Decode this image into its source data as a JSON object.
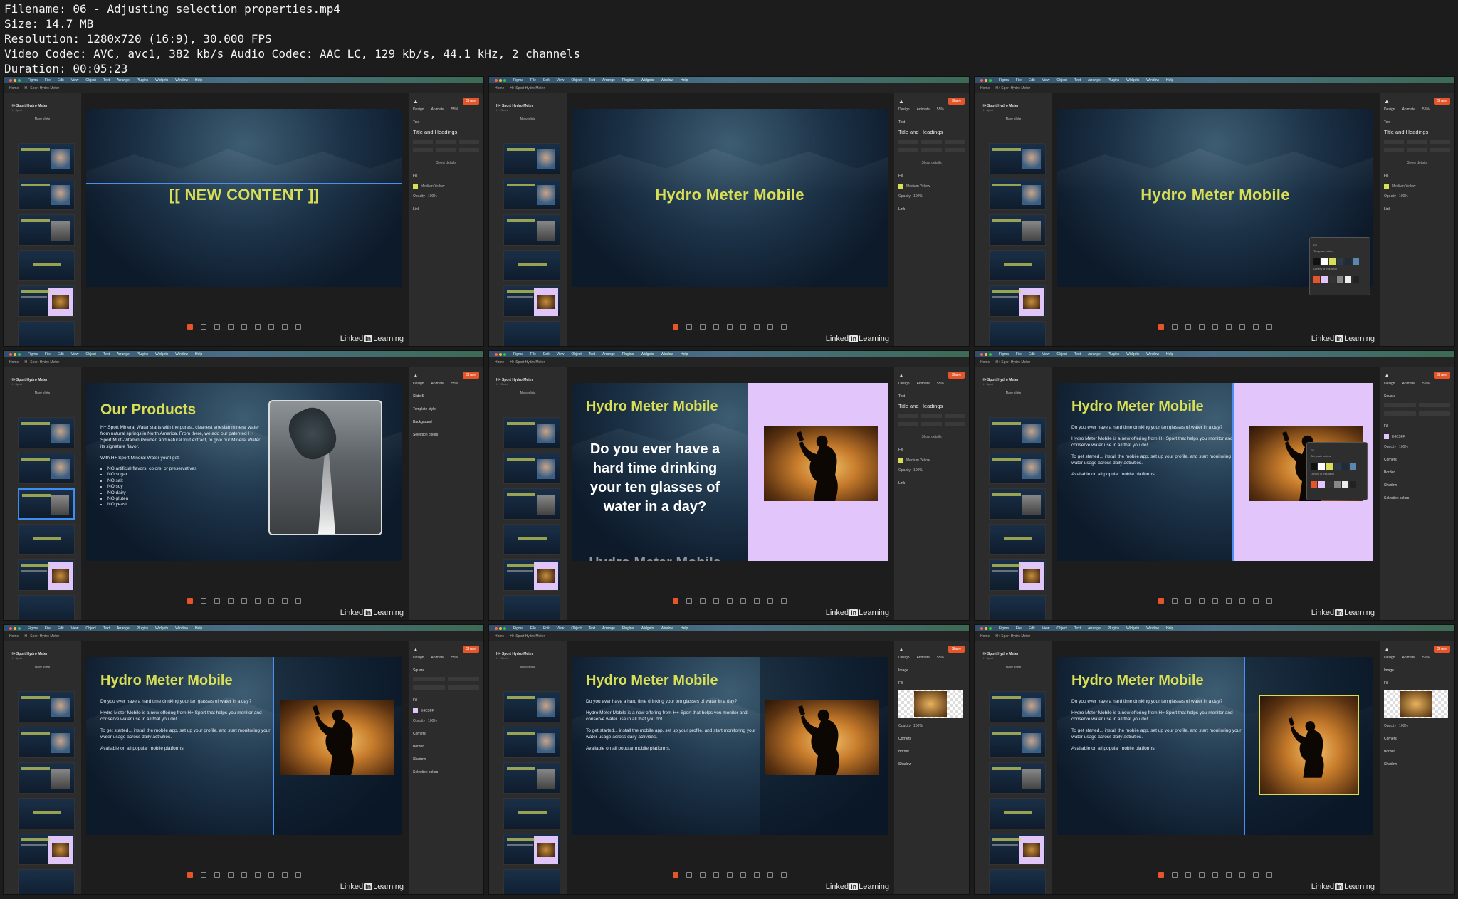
{
  "meta": {
    "filename": "Filename: 06 - Adjusting selection properties.mp4",
    "size": "Size: 14.7 MB",
    "resolution": "Resolution: 1280x720 (16:9), 30.000 FPS",
    "codec": "Video Codec: AVC, avc1, 382 kb/s Audio Codec: AAC LC, 129 kb/s, 44.1 kHz, 2 channels",
    "duration": "Duration: 00:05:23"
  },
  "app": {
    "menu": [
      "Figma",
      "File",
      "Edit",
      "View",
      "Object",
      "Text",
      "Arrange",
      "Plugins",
      "Widgets",
      "Window",
      "Help"
    ],
    "tab_home": "Home",
    "tab_file": "H+ Sport Hydro Meter",
    "project_title": "H+ Sport Hydro Meter",
    "project_sub": "H+ Sport",
    "new_slide": "New slide",
    "share": "Share",
    "design_tab": "Design",
    "animate_tab": "Animate",
    "zoom": "55%",
    "watermark_brand": "Linked",
    "watermark_in": "in",
    "watermark_learning": "Learning"
  },
  "slides": {
    "placeholder_title": "[[ NEW CONTENT ]]",
    "hydro_title": "Hydro Meter Mobile",
    "products_title": "Our Products",
    "products_para1": "H+ Sport Mineral Water starts with the purest, cleanest artesian mineral water from natural springs in North America. From there, we add our patented H+ Sport Multi-Vitamin Powder, and natural fruit extract, to give our Mineral Water its signature flavor.",
    "products_para2": "With H+ Sport Mineral Water you'll get:",
    "products_bullets": [
      "NO artificial flavors, colors, or preservatives",
      "NO sugar",
      "NO salt",
      "NO soy",
      "NO dairy",
      "NO gluten",
      "NO yeast"
    ],
    "question_big": "Do you ever have a hard time drinking your ten glasses of water in a day?",
    "question_big2": "Hydro Meter Mobile is a new offering fr",
    "question_small": "Do you ever have a hard time drinking your ten glasses of water in a day?",
    "intro": "Hydro Meter Mobile is a new offering from H+ Sport that helps you monitor and conserve water use in all that you do!",
    "started": "To get started... install the mobile app, set up your profile, and start monitoring your water usage across daily activities.",
    "available": "Available on all popular mobile platforms."
  },
  "panels": {
    "text": "Text",
    "title_headings": "Title and Headings",
    "show_details": "Show details",
    "fill": "Fill",
    "medium_yellow": "Medium Yellow",
    "opacity": "Opacity",
    "opacity_val": "100%",
    "link": "Link",
    "slide5": "Slide 5",
    "template_style": "Template style",
    "background": "Background",
    "selection_colors": "Selection colors",
    "square": "Square",
    "image": "Image",
    "corners": "Corners",
    "border": "Border",
    "shadow": "Shadow",
    "template_colors": "Template colors",
    "others_in_deck": "Others in this deck",
    "hex_pink": "E4C5FF",
    "color": "Color"
  },
  "colors": {
    "accent": "#d8de55",
    "figma_orange": "#e5552a",
    "selection_blue": "#4b8ff0",
    "pink": "#e1c5fb"
  }
}
